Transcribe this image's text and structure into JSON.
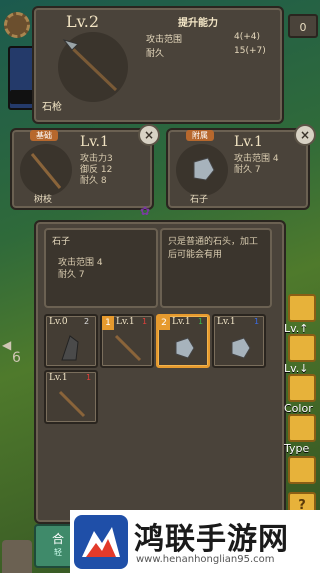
{
  "top_right_counter": "0",
  "side_number": "6",
  "top_card": {
    "level": "Lv.2",
    "item_name": "石枪",
    "section_title": "提升能力",
    "stats": [
      {
        "label": "攻击范围",
        "value": "4(+4)"
      },
      {
        "label": "耐久",
        "value": "15(+7)"
      }
    ]
  },
  "base_card": {
    "tag": "基础",
    "level": "Lv.1",
    "stats": [
      "攻击力3",
      "御反 12",
      "耐久 8"
    ],
    "item_name": "树枝",
    "close_icon": "×"
  },
  "attach_card": {
    "tag": "附属",
    "level": "Lv.1",
    "stats": [
      "攻击范围 4",
      "耐久 7"
    ],
    "item_name": "石子",
    "close_icon": "×"
  },
  "detail": {
    "item_name": "石子",
    "stats": [
      "攻击范围 4",
      "耐久 7"
    ],
    "description": "只是普通的石头，加工后可能会有用"
  },
  "inventory": [
    {
      "level": "Lv.0",
      "badge": "2",
      "badge_color": "#c9c9c9",
      "item": "stone-shard"
    },
    {
      "level": "Lv.1",
      "badge": "1",
      "badge_color": "#e0403a",
      "item": "stick",
      "marker": "1"
    },
    {
      "level": "Lv.1",
      "badge": "1",
      "badge_color": "#3ab84a",
      "item": "pebble",
      "marker": "2",
      "selected": true
    },
    {
      "level": "Lv.1",
      "badge": "1",
      "badge_color": "#3a6ae0",
      "item": "pebble"
    },
    {
      "level": "Lv.1",
      "badge": "1",
      "badge_color": "#e0403a",
      "item": "stick"
    }
  ],
  "side_buttons": [
    {
      "label": "Lv.↑",
      "icon": "sort-icon"
    },
    {
      "label": "Lv.↓",
      "icon": "sort-icon"
    },
    {
      "label": "Color",
      "icon": "sort-icon"
    },
    {
      "label": "Type",
      "icon": "sort-icon"
    },
    {
      "label": "",
      "icon": "document-icon"
    },
    {
      "label": "?",
      "icon": "help-icon"
    }
  ],
  "bottom_button": {
    "line1": "合",
    "line2": "轻"
  },
  "watermark": {
    "title": "鸿联手游网",
    "url": "www.henanhonglian95.com"
  }
}
